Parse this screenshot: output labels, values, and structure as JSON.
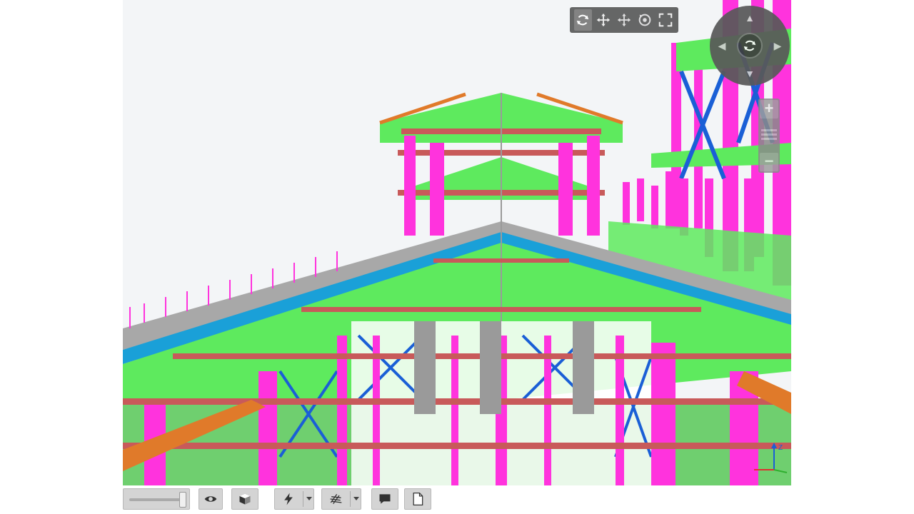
{
  "viewer": {
    "nav_tools": [
      "orbit-icon",
      "pan-icon",
      "move-icon",
      "look-around-icon",
      "fullscreen-icon"
    ],
    "active_tool": "orbit-icon",
    "compass_icons": [
      "compass-up-icon",
      "compass-right-icon",
      "compass-down-icon",
      "compass-left-icon",
      "orbit-center-icon"
    ],
    "zoom": {
      "in_label": "+",
      "out_label": "−"
    },
    "axis_label": "Z"
  },
  "bottom_toolbar": {
    "tools": [
      "transparency-slider",
      "visibility-eye-icon",
      "view-cube-icon",
      "lightning-icon",
      "grid-icon",
      "comment-icon",
      "document-icon"
    ],
    "transparency_level": 1.0
  },
  "colors": {
    "column": "#ff33dd",
    "brace": "#1a5fd6",
    "panel": "#5eea5e",
    "beam": "#c85a5a",
    "purlin": "#e07a2a",
    "steel": "#9a9a9a",
    "sky": "#f4f6f8"
  }
}
